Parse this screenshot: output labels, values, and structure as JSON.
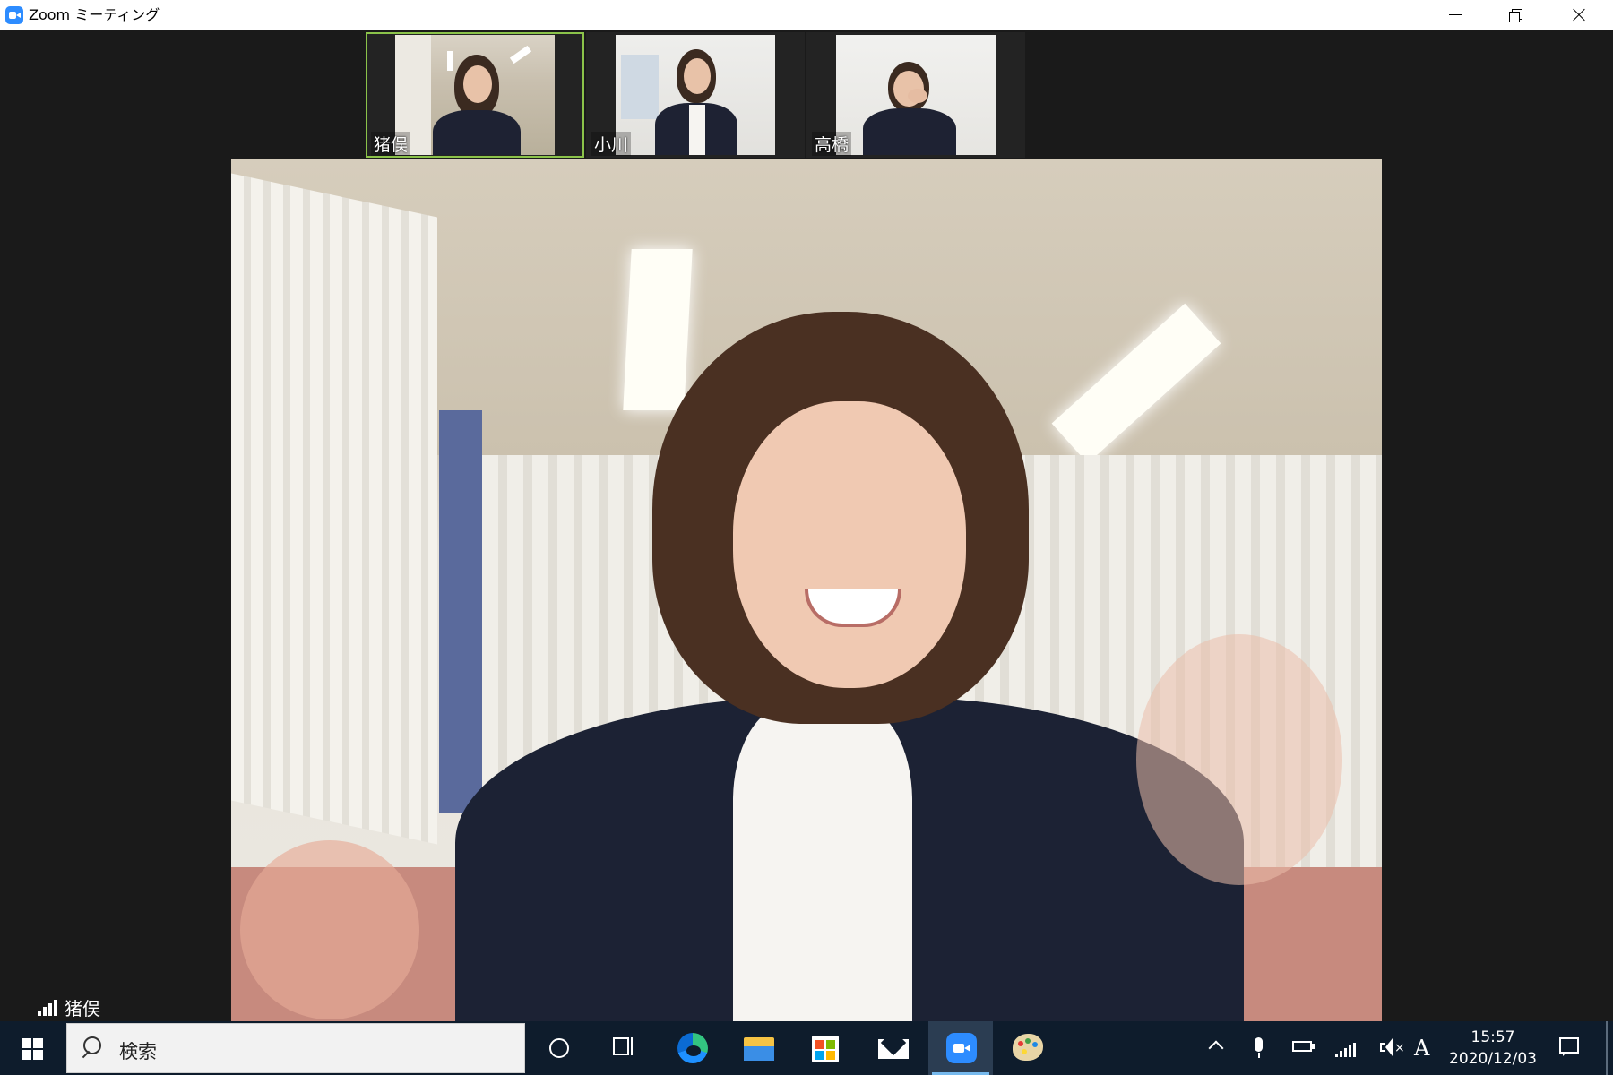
{
  "window": {
    "title": "Zoom ミーティング",
    "icon": "zoom-icon",
    "controls": [
      "minimize-icon",
      "restore-icon",
      "close-icon"
    ]
  },
  "thumbnails": [
    {
      "name": "猪俣",
      "active": true
    },
    {
      "name": "小川",
      "active": false
    },
    {
      "name": "高橋",
      "active": false
    }
  ],
  "main_video": {
    "speaker_name": "猪俣",
    "signal_icon": "signal-strength-icon"
  },
  "taskbar": {
    "search_placeholder": "検索",
    "pinned": [
      "cortana-icon",
      "task-view-icon",
      "edge-icon",
      "file-explorer-icon",
      "store-icon",
      "mail-icon",
      "zoom-icon",
      "paint-icon"
    ],
    "active_app": "zoom-icon",
    "tray": {
      "ime": "A",
      "time": "15:57",
      "date": "2020/12/03"
    }
  },
  "colors": {
    "active_speaker_border": "#8bc34a",
    "zoom_blue": "#2d8cff",
    "taskbar_bg": "#0e1c2c"
  }
}
